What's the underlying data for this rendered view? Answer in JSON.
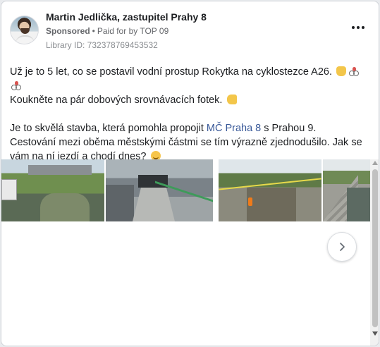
{
  "post": {
    "author": "Martin Jedlička, zastupitel Prahy 8",
    "sponsored_label": "Sponsored",
    "separator": "•",
    "paid_for_by": "Paid for by TOP 09",
    "library_id": "Library ID: 732378769453532",
    "avatar_icon": "avatar-photo",
    "more_icon": "more-options-icon"
  },
  "body": {
    "p1_text": "Už je to 5 let, co se postavil vodní prostup Rokytka na cyklostezce A26.",
    "p1_line2": "Koukněte na pár dobových srovnávacích fotek.",
    "p2_before_link": "Je to skvělá stavba, která pomohla propojit ",
    "p2_link": "MČ Praha 8",
    "p2_after_link": " s Prahou 9. Cestování mezi oběma městskými částmi se tím výrazně zjednodušilo. Jak se vám na ní jezdí a chodí dnes?"
  },
  "carousel": {
    "photos": [
      {
        "name": "photo-1",
        "description_icon": "river-bridge-photo"
      },
      {
        "name": "photo-2",
        "description_icon": "underpass-path-photo"
      },
      {
        "name": "photo-3",
        "description_icon": "construction-channel-photo"
      },
      {
        "name": "photo-4",
        "description_icon": "stone-embankment-photo"
      }
    ],
    "next_icon": "chevron-right-icon"
  },
  "colors": {
    "link": "#385898",
    "text": "#1c1e21",
    "muted": "#65676b"
  }
}
